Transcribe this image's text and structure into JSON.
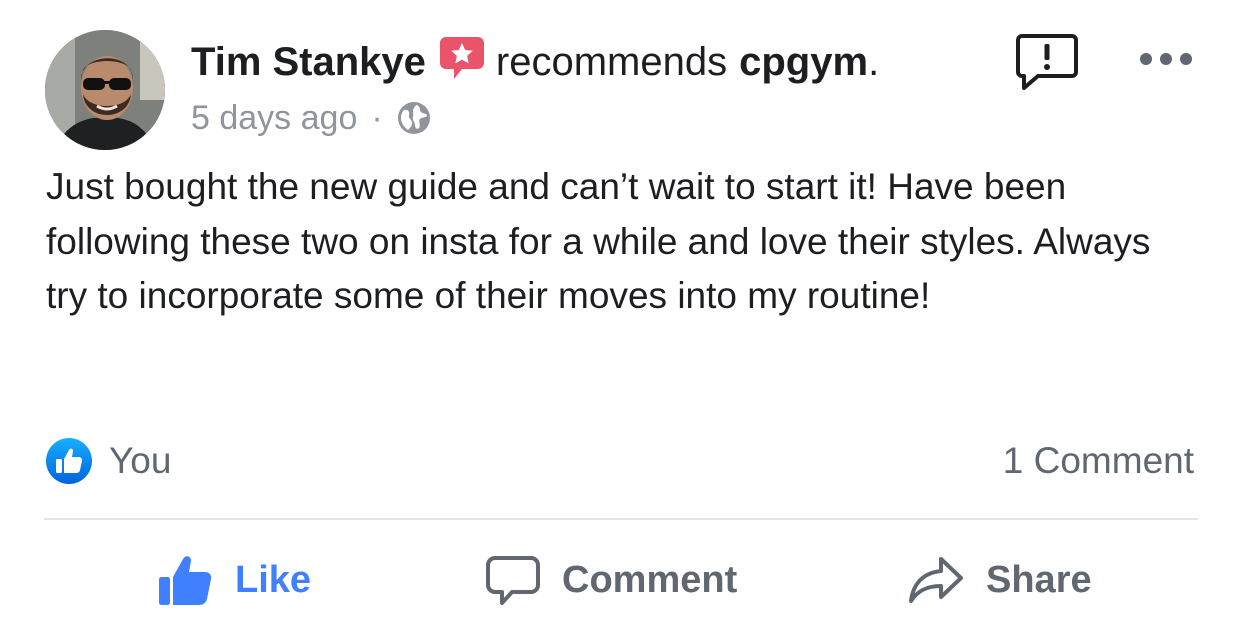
{
  "post": {
    "author": "Tim Stankye",
    "verb": "recommends",
    "page_name": "cpgym",
    "period": ".",
    "timestamp": "5 days ago",
    "separator": "·",
    "audience_icon": "globe-icon",
    "recommend_icon": "recommendation-star-icon",
    "text": "Just bought the new guide and can’t wait to start it! Have been following these two on insta for a while and love their styles. Always try to incorporate some of their moves into my routine!"
  },
  "stats": {
    "reactors": "You",
    "comment_count": "1 Comment"
  },
  "actions": {
    "like_label": "Like",
    "comment_label": "Comment",
    "share_label": "Share"
  },
  "colors": {
    "like_blue": "#4080ff",
    "recommend_red": "#e9546b",
    "text_dark": "#1c1e21",
    "text_gray": "#606770",
    "meta_gray": "#90949c",
    "divider": "#e3e4e8"
  }
}
